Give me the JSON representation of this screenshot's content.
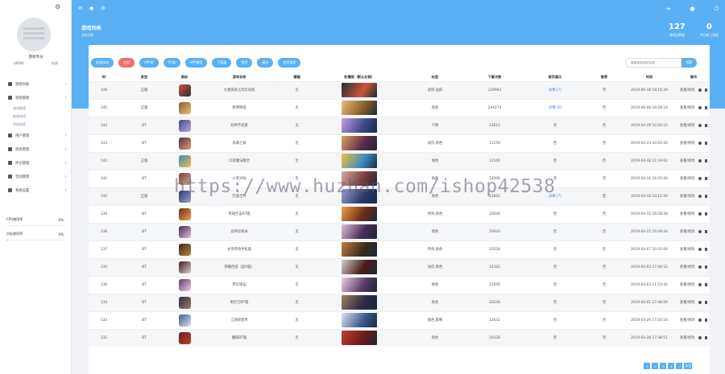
{
  "sidebar": {
    "user_name": "游戏专员",
    "user_money": "$0000",
    "user_status": "在线",
    "menu": [
      {
        "label": "游戏列表",
        "icon": "home-icon",
        "subs": []
      },
      {
        "label": "游戏管理",
        "icon": "gamepad-icon",
        "subs": [
          "游戏管理",
          "新增游戏",
          "添加标签"
        ]
      },
      {
        "label": "用户管理",
        "icon": "users-icon",
        "subs": []
      },
      {
        "label": "资金管理",
        "icon": "money-icon",
        "subs": []
      },
      {
        "label": "评论管理",
        "icon": "comment-icon",
        "subs": []
      },
      {
        "label": "活动管理",
        "icon": "calendar-icon",
        "subs": []
      },
      {
        "label": "系统设置",
        "icon": "settings-icon",
        "subs": []
      }
    ],
    "cpu_label": "CPU使用率",
    "cpu_pct": "0%",
    "cpu_fill": 0.0,
    "mem_label": "内存使用率",
    "mem_pct": "0%",
    "mem_fill": 0.02
  },
  "header": {
    "title": "游戏列表",
    "subtitle": "游戏列表",
    "stat1_num": "127",
    "stat1_label": "游戏总数量",
    "stat2_num": "0",
    "stat2_label": "今日新上游戏"
  },
  "toolbar": [
    "新增游戏",
    "全部",
    "APP端",
    "PC端",
    "APP端游",
    "下载器",
    "推荐",
    "精选",
    "首页推荐"
  ],
  "search": {
    "placeholder": "搜索游戏名称/标签...",
    "button": "搜索"
  },
  "columns": [
    "ID",
    "类型",
    "图标",
    "游戏名称",
    "横幅",
    "轮播图（默认右侧）",
    "标签",
    "下载次数",
    "首页展示",
    "推荐",
    "时间",
    "操作"
  ],
  "rows": [
    {
      "id": "146",
      "type": "正版",
      "name": "大唐侠客之风云再续",
      "banner": "无",
      "tag": "武侠,仙侠",
      "dl": "129993",
      "home": "详情·[7]",
      "rec": "否",
      "time": "2019-06-18 18:16:29"
    },
    {
      "id": "145",
      "type": "正版",
      "name": "原神降临",
      "banner": "无",
      "tag": "角色",
      "dl": "244173",
      "home": "详情·[6]",
      "rec": "否",
      "time": "2019-06-08 18:28:19"
    },
    {
      "id": "144",
      "type": "BT",
      "name": "封神不寂寞",
      "banner": "无",
      "tag": "卡牌",
      "dl": "23015",
      "home": "否",
      "rec": "否",
      "time": "2019-04-29 10:20:22"
    },
    {
      "id": "143",
      "type": "BT",
      "name": "风暴之城",
      "banner": "无",
      "tag": "动作,角色",
      "dl": "11150",
      "home": "否",
      "rec": "否",
      "time": "2019-04-23 10:20:20"
    },
    {
      "id": "142",
      "type": "正版",
      "name": "口袋魔法精灵",
      "banner": "无",
      "tag": "角色",
      "dl": "12100",
      "home": "否",
      "rec": "否",
      "time": "2019-04-18 11:19:02"
    },
    {
      "id": "141",
      "type": "BT",
      "name": "斗罗大陆",
      "banner": "无",
      "tag": "角色",
      "dl": "14006",
      "home": "否",
      "rec": "否",
      "time": "2019-04-16 16:55:06"
    },
    {
      "id": "140",
      "type": "正版",
      "name": "完美世界",
      "banner": "无",
      "tag": "角色",
      "dl": "12662",
      "home": "详情·[7]",
      "rec": "是",
      "time": "2019-04-16 10:12:50"
    },
    {
      "id": "139",
      "type": "BT",
      "name": "英雄合击BT版",
      "banner": "无",
      "tag": "传奇,角色",
      "dl": "10056",
      "home": "否",
      "rec": "否",
      "time": "2019-04-15 16:58:58"
    },
    {
      "id": "138",
      "type": "BT",
      "name": "女神异闻录",
      "banner": "无",
      "tag": "角色",
      "dl": "10643",
      "home": "否",
      "rec": "否",
      "time": "2019-04-15 16:49:24"
    },
    {
      "id": "137",
      "type": "BT",
      "name": "主宰传奇手机版",
      "banner": "无",
      "tag": "传奇,角色",
      "dl": "10230",
      "home": "否",
      "rec": "否",
      "time": "2019-04-07 10:33:04"
    },
    {
      "id": "135",
      "type": "BT",
      "name": "荣耀西游（超V版）",
      "banner": "无",
      "tag": "动作,角色",
      "dl": "14102",
      "home": "否",
      "rec": "否",
      "time": "2019-04-03 17:44:52"
    },
    {
      "id": "136",
      "type": "BT",
      "name": "梦幻诛仙",
      "banner": "无",
      "tag": "角色",
      "dl": "15656",
      "home": "否",
      "rec": "否",
      "time": "2019-04-03 11:53:42"
    },
    {
      "id": "134",
      "type": "BT",
      "name": "明月刀BT版",
      "banner": "无",
      "tag": "角色",
      "dl": "10236",
      "home": "否",
      "rec": "否",
      "time": "2019-04-01 17:48:09"
    },
    {
      "id": "133",
      "type": "BT",
      "name": "江湖侠客传",
      "banner": "无",
      "tag": "角色,策略",
      "dl": "12632",
      "home": "否",
      "rec": "否",
      "time": "2019-03-29 17:20:16"
    },
    {
      "id": "132",
      "type": "BT",
      "name": "魔域BT版",
      "banner": "无",
      "tag": "角色",
      "dl": "10326",
      "home": "否",
      "rec": "否",
      "time": "2019-03-28 17:38:51"
    }
  ],
  "ops_label": "查看/修改",
  "pager": [
    "1",
    "2",
    "3",
    "4",
    "...",
    "末页"
  ],
  "watermark": "https://www.huzhan.com/ishop42538",
  "colors": {
    "primary": "#5ab0f4",
    "danger": "#f26d6d"
  }
}
